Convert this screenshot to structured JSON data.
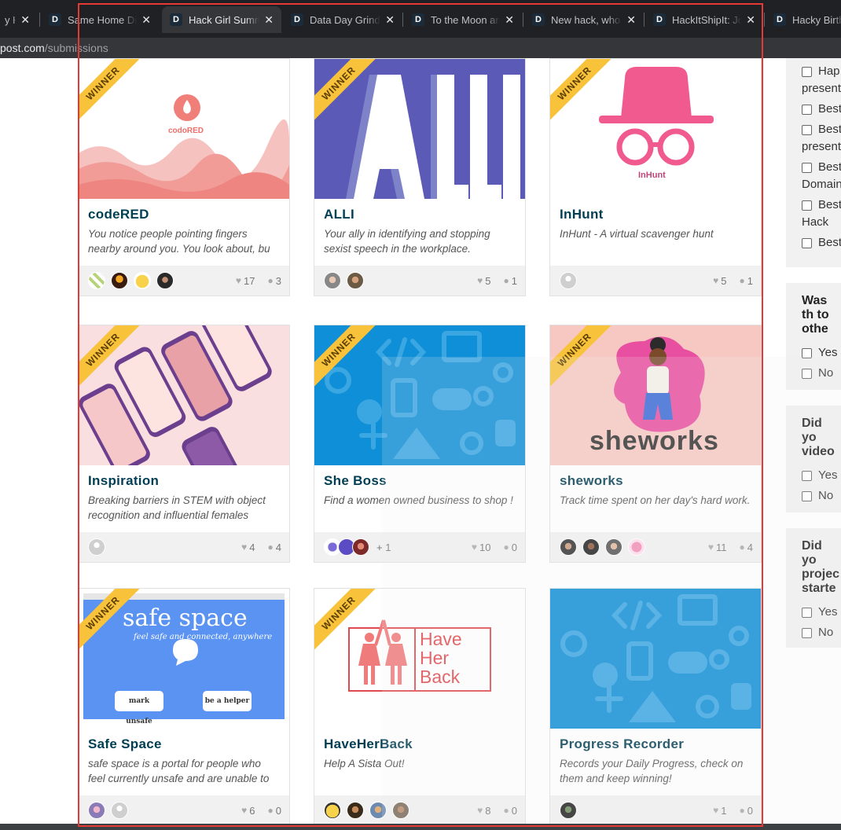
{
  "browser": {
    "tabs": [
      {
        "title": "y Ha",
        "active": false
      },
      {
        "title": "Same Home Diff",
        "active": false
      },
      {
        "title": "Hack Girl Summe",
        "active": true
      },
      {
        "title": "Data Day Grind: I",
        "active": false
      },
      {
        "title": "To the Moon and",
        "active": false
      },
      {
        "title": "New hack, who t",
        "active": false
      },
      {
        "title": "HackItShipIt: Join",
        "active": false
      },
      {
        "title": "Hacky Birtho",
        "active": false
      }
    ],
    "close_glyph": "✕",
    "favicon_letter": "D",
    "url_domain": "post.com",
    "url_path": "/submissions"
  },
  "ribbon_label": "WINNER",
  "cards": [
    {
      "title": "codeRED",
      "description": "You notice people pointing fingers nearby around you. You look about, bu",
      "likes": "17",
      "comments": "3",
      "winner": true,
      "thumb_text": "codoRED",
      "more": ""
    },
    {
      "title": "ALLI",
      "description": "Your ally in identifying and stopping sexist speech in the workplace.",
      "likes": "5",
      "comments": "1",
      "winner": true,
      "thumb_text": "ALLI",
      "more": ""
    },
    {
      "title": "InHunt",
      "description": "InHunt - A virtual scavenger hunt",
      "likes": "5",
      "comments": "1",
      "winner": true,
      "thumb_text": "InHunt",
      "more": ""
    },
    {
      "title": "Inspiration",
      "description": "Breaking barriers in STEM with object recognition and influential females",
      "likes": "4",
      "comments": "4",
      "winner": true,
      "thumb_text": "",
      "more": ""
    },
    {
      "title": "She Boss",
      "description": "Find a women owned business to shop !",
      "likes": "10",
      "comments": "0",
      "winner": true,
      "thumb_text": "",
      "more": "+ 1"
    },
    {
      "title": "sheworks",
      "description": "Track time spent on her day's hard work.",
      "likes": "11",
      "comments": "4",
      "winner": true,
      "thumb_text": "sheworks",
      "more": ""
    },
    {
      "title": "Safe Space",
      "description": "safe space is a portal for people who feel currently unsafe and are unable to",
      "likes": "6",
      "comments": "0",
      "winner": true,
      "thumb_text": "safe space",
      "thumb_sub": "feel safe and connected, anywhere",
      "thumb_btn1": "mark unsafe",
      "thumb_btn2": "be a helper",
      "more": ""
    },
    {
      "title": "HaveHerBack",
      "description": "Help A Sista Out!",
      "likes": "8",
      "comments": "0",
      "winner": true,
      "thumb_text": "Have Her Back",
      "more": ""
    },
    {
      "title": "Progress Recorder",
      "description": "Records your Daily Progress, check on them and keep winning!",
      "likes": "1",
      "comments": "0",
      "winner": false,
      "thumb_text": "",
      "more": ""
    }
  ],
  "sidebar": {
    "prize_filters": [
      "Hap",
      "present",
      "Best",
      "Best",
      "present",
      "Best",
      "Domain",
      "Best",
      "Hack",
      "Best"
    ],
    "q1": {
      "title": "Was th to othe",
      "options": [
        "Yes",
        "No"
      ]
    },
    "q2": {
      "title": "Did yo video",
      "options": [
        "Yes",
        "No"
      ]
    },
    "q3": {
      "title": "Did yo projec starte",
      "options": [
        "Yes",
        "No"
      ]
    }
  },
  "colors": {
    "accent": "#003e54",
    "ribbon": "#f8c23a",
    "highlight": "#e53935"
  }
}
